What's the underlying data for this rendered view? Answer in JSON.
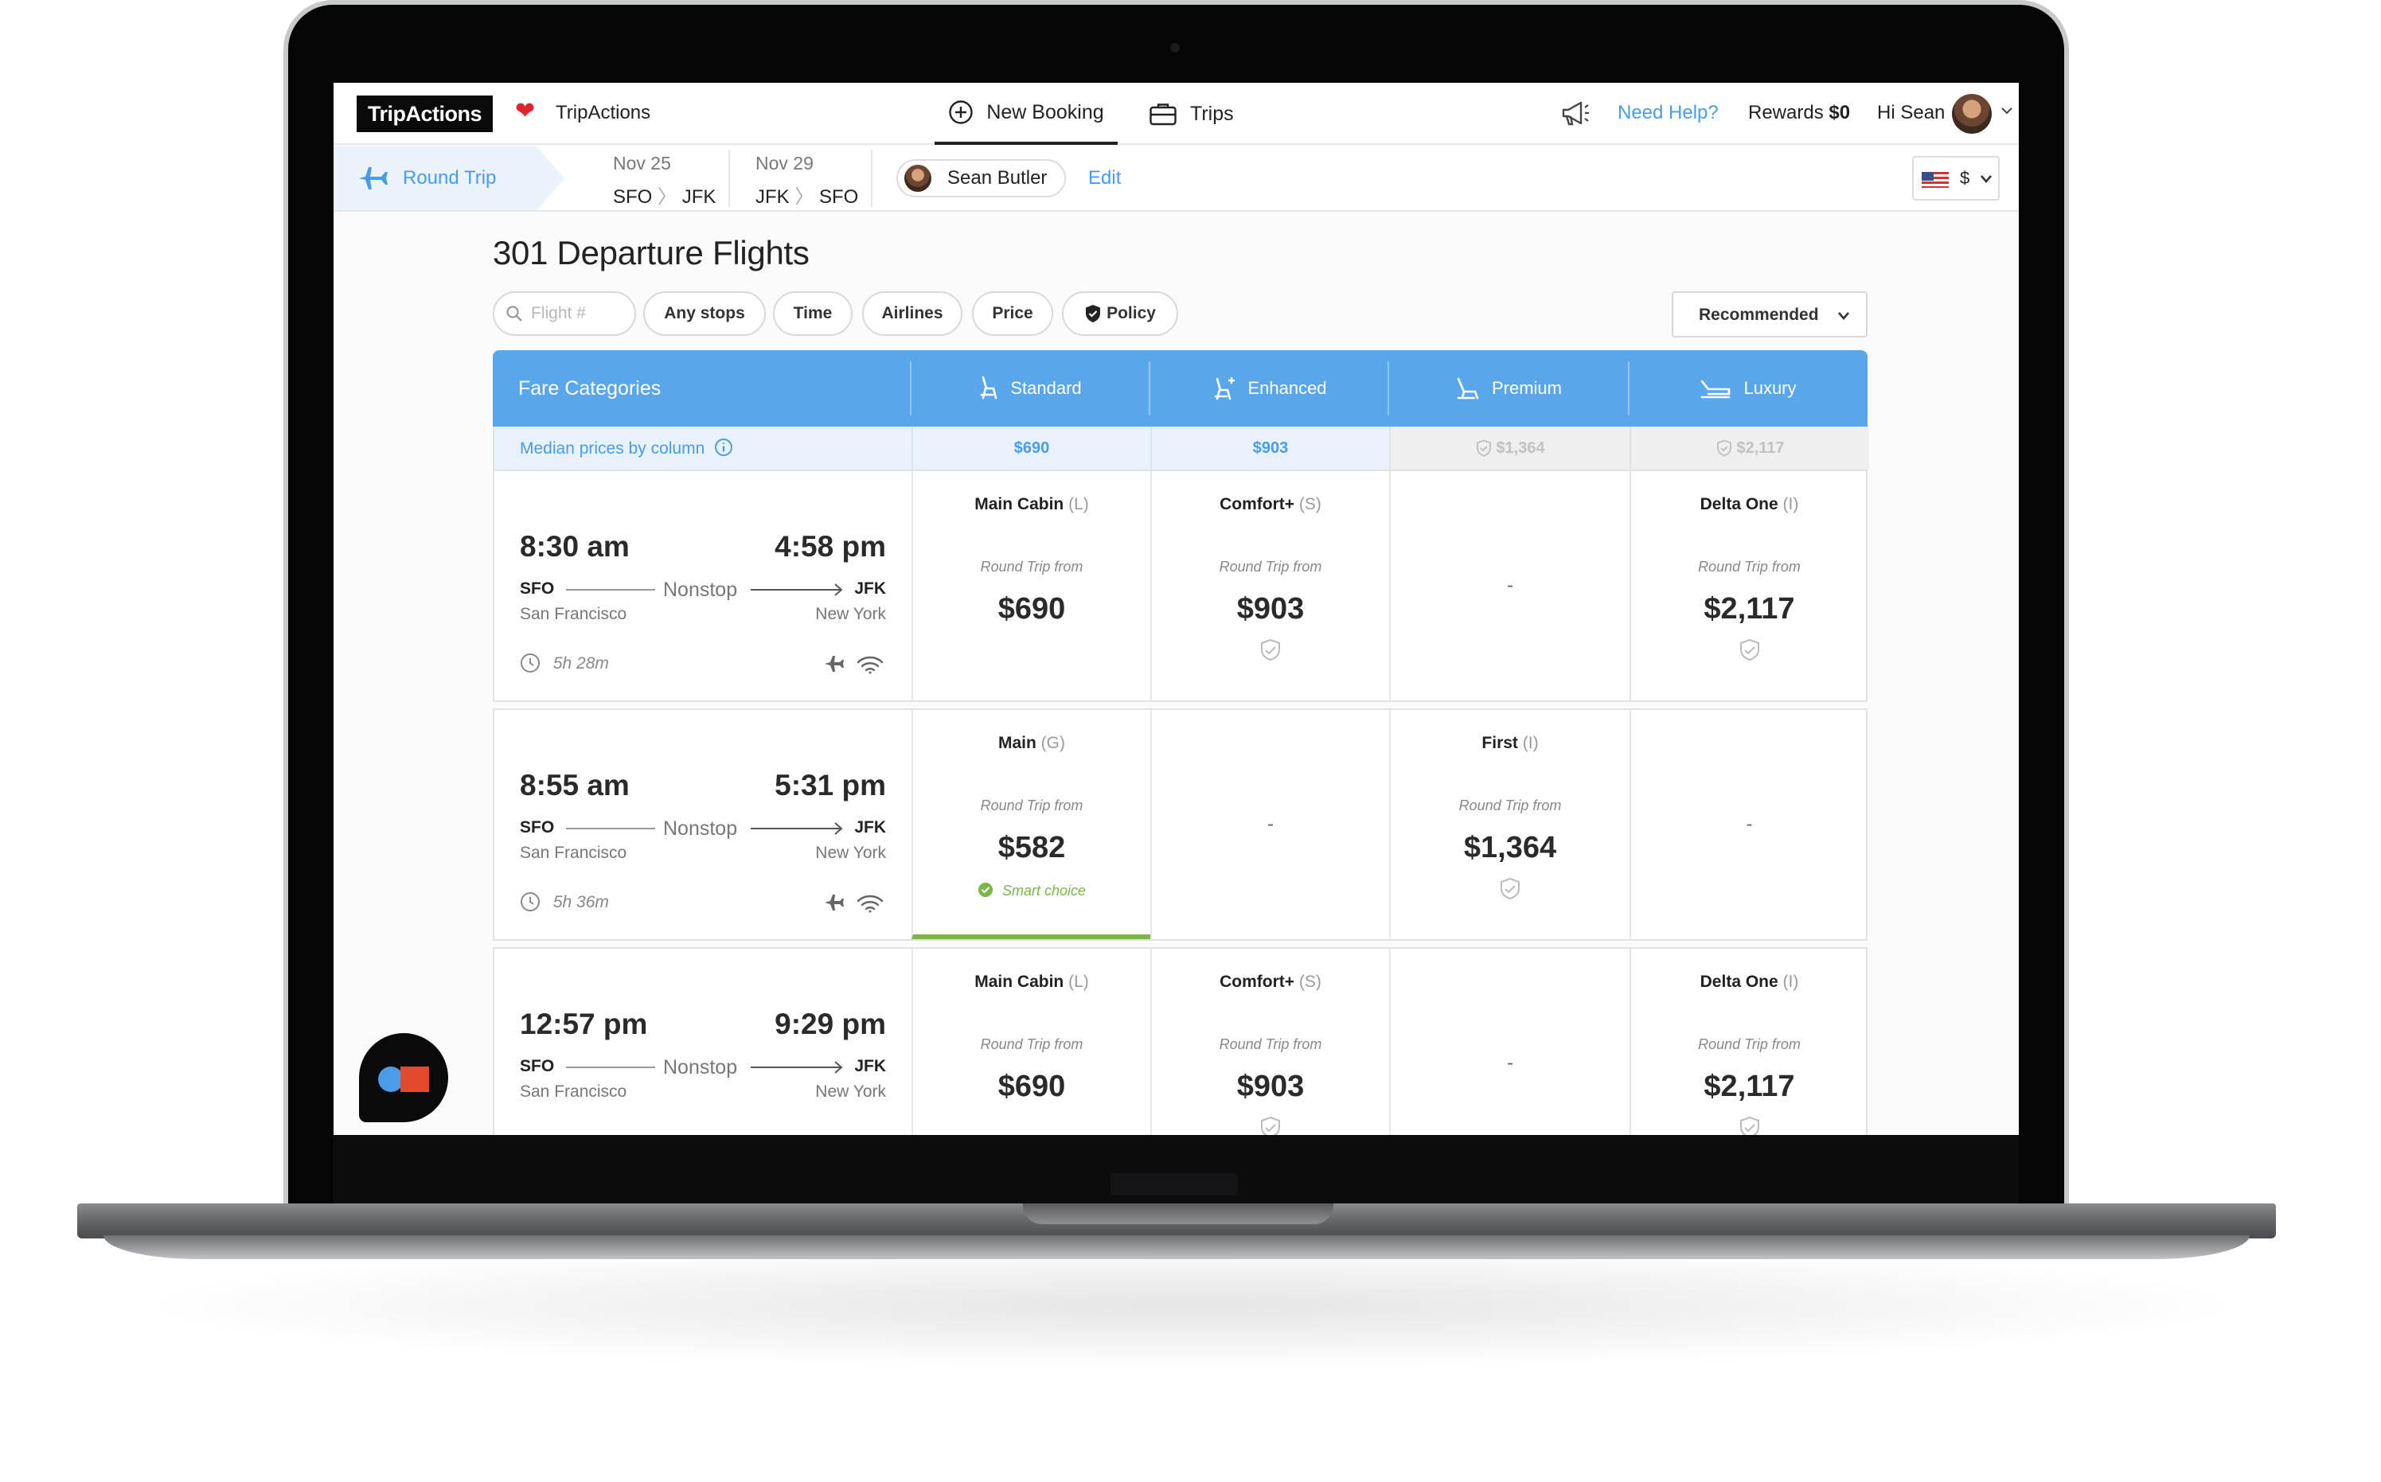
{
  "brand": {
    "logo_text": "TripActions",
    "org_name": "TripActions"
  },
  "nav": {
    "tabs": [
      {
        "label": "New Booking"
      },
      {
        "label": "Trips"
      }
    ],
    "help_label": "Need Help?",
    "rewards_label": "Rewards",
    "rewards_value": "$0",
    "greeting": "Hi Sean"
  },
  "trip": {
    "type_label": "Round Trip",
    "legs": [
      {
        "date": "Nov 25",
        "from": "SFO",
        "to": "JFK"
      },
      {
        "date": "Nov 29",
        "from": "JFK",
        "to": "SFO"
      }
    ],
    "traveler_name": "Sean Butler",
    "edit_label": "Edit",
    "currency_symbol": "$"
  },
  "results": {
    "title": "301 Departure Flights",
    "search_placeholder": "Flight #",
    "filters": [
      "Any stops",
      "Time",
      "Airlines",
      "Price",
      "Policy"
    ],
    "sort_label": "Recommended"
  },
  "fare_table": {
    "header_label": "Fare Categories",
    "columns": [
      "Standard",
      "Enhanced",
      "Premium",
      "Luxury"
    ],
    "median_label": "Median prices by column",
    "medians": [
      "$690",
      "$903",
      "$1,364",
      "$2,117"
    ],
    "round_trip_from": "Round Trip from",
    "rows": [
      {
        "dep": "8:30 am",
        "arr": "4:58 pm",
        "from": "SFO",
        "to": "JFK",
        "from_city": "San Francisco",
        "to_city": "New York",
        "stops": "Nonstop",
        "duration": "5h 28m",
        "cells": [
          {
            "cls": "Main Cabin",
            "code": "(L)",
            "price": "$690"
          },
          {
            "cls": "Comfort+",
            "code": "(S)",
            "price": "$903"
          },
          {
            "dash": "-"
          },
          {
            "cls": "Delta One",
            "code": "(I)",
            "price": "$2,117"
          }
        ]
      },
      {
        "dep": "8:55 am",
        "arr": "5:31 pm",
        "from": "SFO",
        "to": "JFK",
        "from_city": "San Francisco",
        "to_city": "New York",
        "stops": "Nonstop",
        "duration": "5h 36m",
        "cells": [
          {
            "cls": "Main",
            "code": "(G)",
            "price": "$582",
            "badge": "Smart choice"
          },
          {
            "dash": "-"
          },
          {
            "cls": "First",
            "code": "(I)",
            "price": "$1,364"
          },
          {
            "dash": "-"
          }
        ]
      },
      {
        "dep": "12:57 pm",
        "arr": "9:29 pm",
        "from": "SFO",
        "to": "JFK",
        "from_city": "San Francisco",
        "to_city": "New York",
        "stops": "Nonstop",
        "cells": [
          {
            "cls": "Main Cabin",
            "code": "(L)",
            "price": "$690"
          },
          {
            "cls": "Comfort+",
            "code": "(S)",
            "price": "$903"
          },
          {
            "dash": "-"
          },
          {
            "cls": "Delta One",
            "code": "(I)",
            "price": "$2,117"
          }
        ]
      }
    ]
  },
  "colors": {
    "accent": "#5aa6ea",
    "link": "#4a9be8",
    "success": "#7ab648",
    "brand_red": "#e0242c"
  },
  "icons": [
    "heart-icon",
    "plus-circle-icon",
    "briefcase-icon",
    "megaphone-icon",
    "plane-icon",
    "search-icon",
    "shield-icon",
    "seat-icon",
    "info-icon",
    "clock-icon",
    "wifi-icon",
    "chevron-down-icon",
    "chat-icon"
  ]
}
